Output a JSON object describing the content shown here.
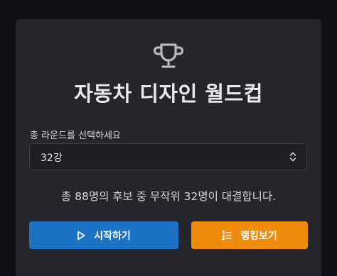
{
  "app": {
    "title": "자동차 디자인 월드컵",
    "trophy_icon": "trophy-icon"
  },
  "round_select": {
    "label": "총 라운드를 선택하세요",
    "selected": "32강",
    "icon": "chevron-up-down-icon"
  },
  "description": "총 88명의 후보 중 무작위 32명이 대결합니다.",
  "buttons": {
    "start_label": "시작하기",
    "start_icon": "play-icon",
    "rank_label": "랭킹보기",
    "rank_icon": "list-ordered-icon"
  },
  "colors": {
    "background": "#0f1014",
    "card": "#24262c",
    "primary": "#1c72c4",
    "accent": "#f08c0c"
  }
}
